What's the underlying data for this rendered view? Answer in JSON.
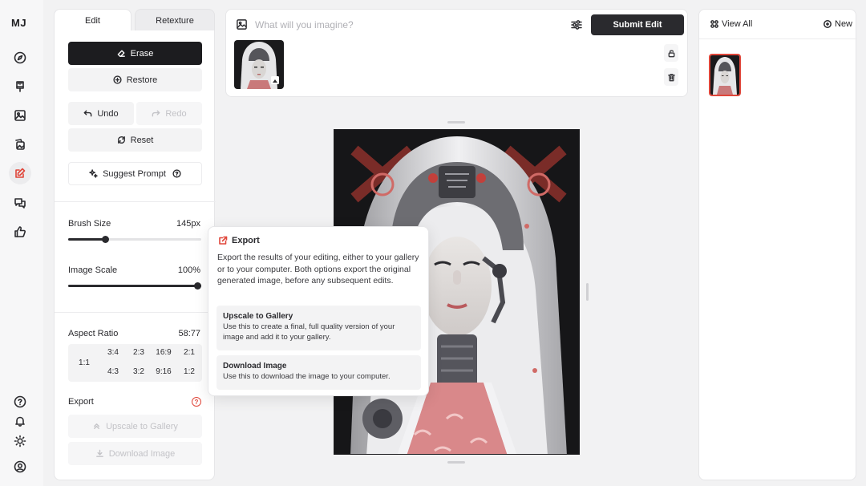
{
  "app": {
    "logo": "MJ"
  },
  "rail": {
    "items": [
      {
        "name": "explore",
        "icon": "compass-icon"
      },
      {
        "name": "create",
        "icon": "brush-icon"
      },
      {
        "name": "organize",
        "icon": "image-icon"
      },
      {
        "name": "gallery",
        "icon": "images-icon"
      },
      {
        "name": "edit",
        "icon": "edit-icon",
        "active": true
      },
      {
        "name": "chat",
        "icon": "chat-icon"
      },
      {
        "name": "tasks",
        "icon": "thumbs-up-icon"
      }
    ],
    "bottom": [
      {
        "name": "help",
        "icon": "help-icon"
      },
      {
        "name": "notifications",
        "icon": "bell-icon"
      },
      {
        "name": "theme",
        "icon": "sun-icon"
      },
      {
        "name": "account",
        "icon": "user-icon"
      }
    ]
  },
  "tabs": {
    "edit": "Edit",
    "retexture": "Retexture"
  },
  "tools": {
    "erase": "Erase",
    "restore": "Restore",
    "undo": "Undo",
    "redo": "Redo",
    "reset": "Reset",
    "suggest_prompt": "Suggest Prompt"
  },
  "brush": {
    "label": "Brush Size",
    "value": "145px",
    "fraction": 0.28
  },
  "scale": {
    "label": "Image Scale",
    "value": "100%",
    "fraction": 1.0
  },
  "aspect": {
    "label": "Aspect Ratio",
    "value": "58:77",
    "square": "1:1",
    "top": [
      "3:4",
      "2:3",
      "16:9",
      "2:1"
    ],
    "bottom": [
      "4:3",
      "3:2",
      "9:16",
      "1:2"
    ]
  },
  "export": {
    "label": "Export",
    "upscale": "Upscale to Gallery",
    "download": "Download Image"
  },
  "prompt": {
    "placeholder": "What will you imagine?",
    "submit": "Submit Edit"
  },
  "right": {
    "view_all": "View All",
    "new": "New"
  },
  "tooltip": {
    "title": "Export",
    "description": "Export the results of your editing, either to your gallery or to your computer. Both options export the original generated image, before any subsequent edits.",
    "upscale_title": "Upscale to Gallery",
    "upscale_desc": "Use this to create a final, full quality version of your image and add it to your gallery.",
    "download_title": "Download Image",
    "download_desc": "Use this to download the image to your computer."
  },
  "colors": {
    "accent": "#e0463a",
    "dark": "#1c1c1f"
  }
}
